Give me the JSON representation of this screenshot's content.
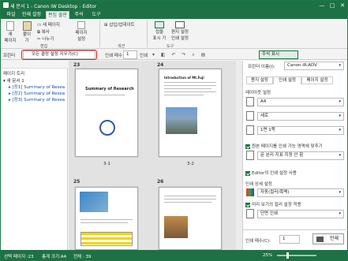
{
  "window": {
    "title": "새 문서 1 - Canon iW Desktop - Editor",
    "min": "—",
    "max": "□",
    "close": "✕"
  },
  "tabs": [
    "파일",
    "인쇄 설정",
    "편집 출판",
    "주석",
    "도구"
  ],
  "ribbon": {
    "new_label": "새\n페이지",
    "paste_label": "붙이\n기",
    "new_group_label": "새 페이지",
    "copy": "복사",
    "cut": "나누기",
    "page_settings": "페이지\n설정",
    "edit_label": "편집",
    "insert_update": "삽입/업데이트",
    "section_label": "섹션",
    "show_fold": "접을\n표시 기",
    "print_settings": "편지 설정\n인쇄 설정",
    "tools_label": "도구"
  },
  "toolbar2": {
    "label": "프린터",
    "highlighted": "모든 결정 설정 지우기(C)",
    "print_copies_label": "인쇄 매수",
    "copies_value": "1",
    "zoom_label": "인쇄",
    "notes_label": "주석 표시"
  },
  "left": {
    "title": "페이지 트리",
    "items": [
      "새 문서 1",
      "[장1] Summary of Resea",
      "[장2] Summary of Resea",
      "[장3] Summary of Resea"
    ]
  },
  "center": {
    "pages": [
      {
        "num": "23",
        "label": "3-1",
        "title": "Summary of Research"
      },
      {
        "num": "24",
        "label": "3-2",
        "title": "Introduction of Mt.Fuji"
      },
      {
        "num": "25",
        "label": ""
      },
      {
        "num": "26",
        "label": ""
      }
    ]
  },
  "right": {
    "printer_label": "프린터 이름(I):",
    "printer_value": "Canon iR-ADV",
    "tabs": [
      "용지 설정",
      "인쇄 설정",
      "페이지 설정"
    ],
    "layout_label": "레이아웃 설정",
    "paper": "A4",
    "orientation": "세로",
    "pages_per_sheet": "1면 1쪽",
    "fit_label": "원본 페이지를 인쇄 가능 영역에 맞추기",
    "sort_label": "문 분리 지표 지정 안 함",
    "editor_label": "Editor의 인쇄 설정 사용",
    "detail_label": "인쇄 상세 설정",
    "duplex_label": "자동(컬러/흑백)",
    "output_label": "미리 보기의 컬러 설정 적용",
    "single": "단면 인쇄",
    "copies_label": "인쇄 매수(C):",
    "copies_value": "1",
    "print_button": "인쇄"
  },
  "status": {
    "left": "선택 페이지 :23",
    "center": "총계 크기:A4",
    "pages": "전체 : 39",
    "zoom": "25%"
  }
}
